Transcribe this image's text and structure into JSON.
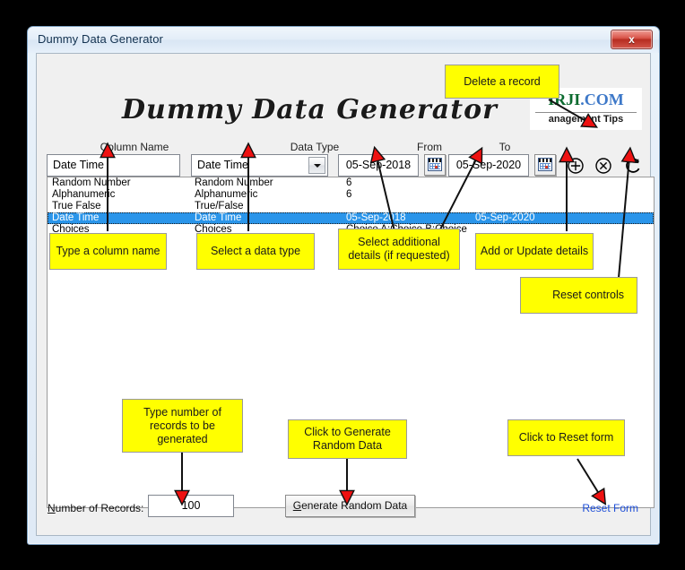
{
  "window": {
    "title": "Dummy Data Generator",
    "close_label": "x"
  },
  "header": {
    "app_title": "Dummy Data Generator",
    "logo_line1_a": "IRJI",
    "logo_line1_b": ".COM",
    "logo_line2": "anagement Tips"
  },
  "form": {
    "labels": {
      "column_name": "Column Name",
      "data_type": "Data Type",
      "from": "From",
      "to": "To"
    },
    "column_name_value": "Date Time",
    "data_type_value": "Date Time",
    "from_value": "05-Sep-2018",
    "to_value": "05-Sep-2020",
    "data_type_options": [
      "Random Number",
      "Alphanumeric",
      "True/False",
      "Date Time",
      "Choices"
    ]
  },
  "list": {
    "rows": [
      {
        "name": "Random Number",
        "type": "Random Number",
        "detail1": "6",
        "detail2": "",
        "selected": false
      },
      {
        "name": "Alphanumeric",
        "type": "Alphanumeric",
        "detail1": "6",
        "detail2": "",
        "selected": false
      },
      {
        "name": "True False",
        "type": "True/False",
        "detail1": "",
        "detail2": "",
        "selected": false
      },
      {
        "name": "Date Time",
        "type": "Date Time",
        "detail1": "05-Sep-2018",
        "detail2": "05-Sep-2020",
        "selected": true
      },
      {
        "name": "Choices",
        "type": "Choices",
        "detail1": "Choice A;Choice B;Choice",
        "detail2": "",
        "selected": false
      }
    ]
  },
  "bottom": {
    "records_label_first": "N",
    "records_label_rest": "umber of Records:",
    "records_value": "100",
    "generate_first": "G",
    "generate_rest": "enerate Random Data",
    "reset_link": "Reset Form"
  },
  "annotations": {
    "delete_record": "Delete a record",
    "type_column_name": "Type a column name",
    "select_data_type": "Select a data type",
    "select_details": "Select additional\ndetails (if requested)",
    "add_update": "Add or Update details",
    "reset_controls": "Reset controls",
    "type_number": "Type number of\nrecords to be\ngenerated",
    "click_generate": "Click to Generate\nRandom Data",
    "click_reset": "Click to Reset form"
  },
  "colors": {
    "callout_bg": "#ffff00",
    "arrow_fill": "#ee1111",
    "selection": "#2a95ea",
    "link": "#1d4ed8"
  }
}
